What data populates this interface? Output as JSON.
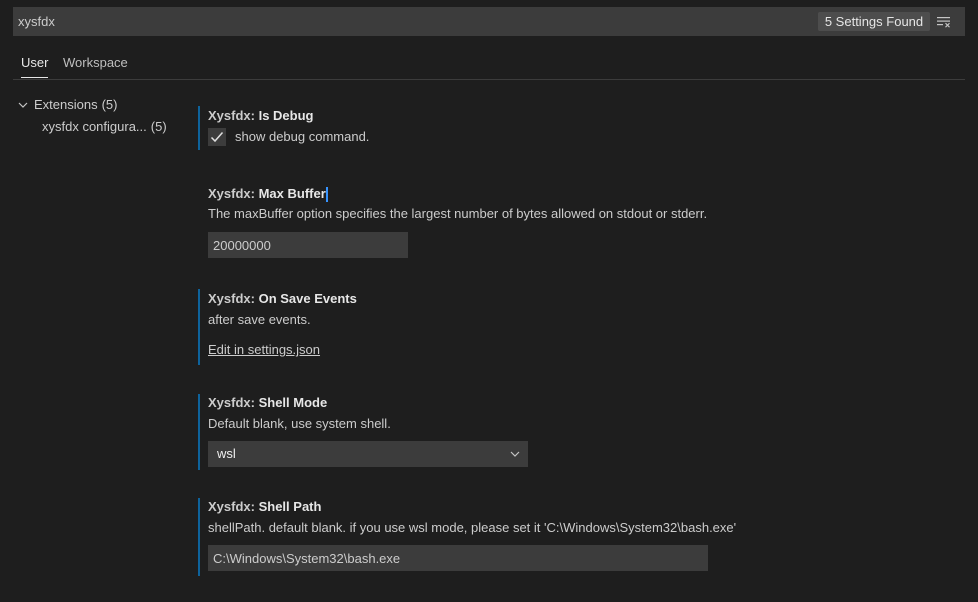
{
  "search": {
    "value": "xysfdx",
    "results_badge": "5 Settings Found",
    "clear_icon": "clear-filter-icon"
  },
  "tabs": [
    {
      "label": "User",
      "active": true
    },
    {
      "label": "Workspace",
      "active": false
    }
  ],
  "toc": {
    "items": [
      {
        "label": "Extensions",
        "count": "(5)",
        "expanded": true
      },
      {
        "label": "xysfdx configura...",
        "count": "(5)"
      }
    ]
  },
  "settings": [
    {
      "category": "Xysfdx:",
      "name": "Is Debug",
      "checkbox_label": "show debug command.",
      "checked": true
    },
    {
      "category": "Xysfdx:",
      "name": "Max Buffer",
      "description": "The maxBuffer option specifies the largest number of bytes allowed on stdout or stderr.",
      "value": "20000000"
    },
    {
      "category": "Xysfdx:",
      "name": "On Save Events",
      "description": "after save events.",
      "link": "Edit in settings.json"
    },
    {
      "category": "Xysfdx:",
      "name": "Shell Mode",
      "description": "Default blank, use system shell.",
      "selected": "wsl"
    },
    {
      "category": "Xysfdx:",
      "name": "Shell Path",
      "description": "shellPath. default blank. if you use wsl mode, please set it 'C:\\Windows\\System32\\bash.exe'",
      "value": "C:\\Windows\\System32\\bash.exe"
    }
  ],
  "colors": {
    "background": "#1e1e1e",
    "input_background": "#3c3c3c",
    "modified_indicator": "#0e639c",
    "text": "#cccccc",
    "cursor": "#3794ff"
  }
}
